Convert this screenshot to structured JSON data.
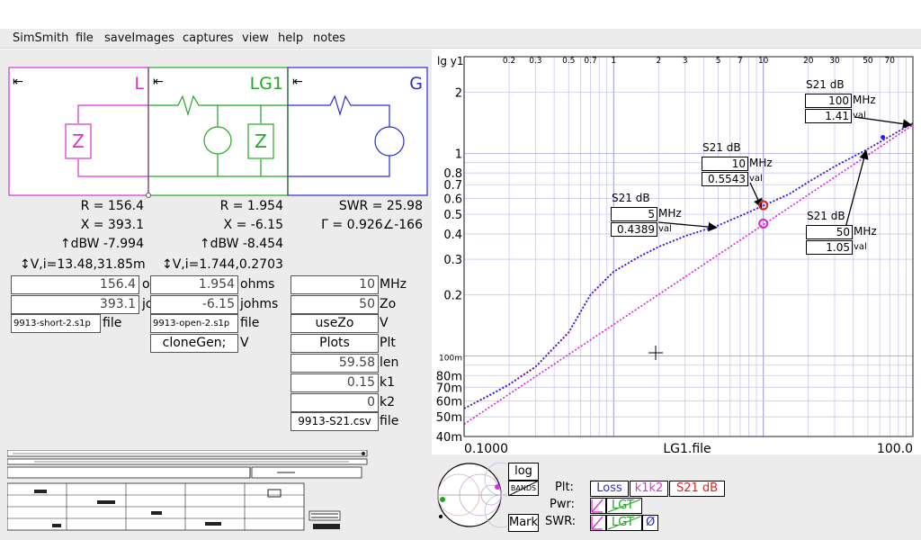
{
  "menu": {
    "items": [
      "SimSmith",
      "file",
      "saveImages",
      "captures",
      "view",
      "help",
      "notes"
    ]
  },
  "circuit": {
    "blocks": [
      {
        "name": "L",
        "color": "#d633d6"
      },
      {
        "name": "LG1",
        "color": "#22a822"
      },
      {
        "name": "G",
        "color": "#2a2ad6"
      }
    ],
    "arrow_glyph": "⇤",
    "z_glyph": "Z"
  },
  "readouts": {
    "col1": {
      "r": "R = 156.4",
      "x": "X = 393.1",
      "dbw": "↑dBW -7.994",
      "vi": "↕V,i=13.48,31.85m"
    },
    "col2": {
      "r": "R = 1.954",
      "x": "X = -6.15",
      "dbw": "↑dBW -8.454",
      "vi": "↕V,i=1.744,0.2703"
    },
    "col3": {
      "swr": "SWR = 25.98",
      "gamma": "Γ = 0.926∠-166"
    }
  },
  "fields": {
    "col1": [
      {
        "value": "156.4",
        "label": "ohms"
      },
      {
        "value": "393.1",
        "label": "johms"
      },
      {
        "value": "9913-short-2.s1p",
        "label": "file"
      }
    ],
    "col2": [
      {
        "value": "1.954",
        "label": "ohms"
      },
      {
        "value": "-6.15",
        "label": "johms"
      },
      {
        "value": "9913-open-2.s1p",
        "label": "file"
      },
      {
        "value": "cloneGen;",
        "label": "V"
      }
    ],
    "col3": [
      {
        "value": "10",
        "label": "MHz"
      },
      {
        "value": "50",
        "label": "Zo"
      },
      {
        "value": "useZo",
        "label": "V"
      },
      {
        "value": "Plots",
        "label": "Plt"
      },
      {
        "value": "59.58",
        "label": "len"
      },
      {
        "value": "0.15",
        "label": "k1"
      },
      {
        "value": "0",
        "label": "k2"
      },
      {
        "value": "9913-S21.csv",
        "label": "file"
      }
    ]
  },
  "chart_data": {
    "type": "line",
    "ylabel": "lg y1",
    "xlabel": "LG1.file",
    "x_scale": "log",
    "y_scale": "log",
    "xlim": [
      0.1,
      100
    ],
    "ylim": [
      0.04,
      3
    ],
    "x_top_ticks": [
      "0.2",
      "0.3",
      "0.5",
      "0.7",
      "1",
      "2",
      "3",
      "5",
      "7",
      "10",
      "20",
      "30",
      "50",
      "70"
    ],
    "x_bottom_ticks": [
      "0.1000",
      "100.0"
    ],
    "y_ticks": [
      "2",
      "1",
      "0.8",
      "0.7",
      "0.6",
      "0.5",
      "0.4",
      "0.3",
      "0.2",
      "100m",
      "80m",
      "70m",
      "60m",
      "50m",
      "40m"
    ],
    "grid": true,
    "series": [
      {
        "color": "#ff2020",
        "style": "dotted",
        "x": [
          0.1,
          0.15,
          0.2,
          0.3,
          0.5,
          0.7,
          1,
          1.5,
          2,
          3,
          5,
          7,
          10,
          15,
          20,
          30,
          50,
          100
        ],
        "y": [
          0.055,
          0.064,
          0.072,
          0.088,
          0.13,
          0.2,
          0.26,
          0.31,
          0.345,
          0.39,
          0.44,
          0.49,
          0.55,
          0.63,
          0.72,
          0.86,
          1.05,
          1.41
        ]
      },
      {
        "color": "#2020ff",
        "style": "dotted",
        "x": [
          0.1,
          0.15,
          0.2,
          0.3,
          0.5,
          0.7,
          1,
          1.5,
          2,
          3,
          5,
          7,
          10,
          15,
          20,
          30,
          50,
          100
        ],
        "y": [
          0.055,
          0.0645,
          0.0725,
          0.0885,
          0.131,
          0.201,
          0.261,
          0.311,
          0.346,
          0.391,
          0.441,
          0.491,
          0.552,
          0.632,
          0.722,
          0.862,
          1.052,
          1.41
        ]
      },
      {
        "color": "#e020e0",
        "style": "dotted",
        "x": [
          0.1,
          100
        ],
        "y": [
          0.046,
          1.38
        ]
      }
    ],
    "markers": [
      {
        "label": "S21 dB",
        "freq": "5",
        "unit": "MHz",
        "val": "0.4389",
        "val_unit": "val"
      },
      {
        "label": "S21 dB",
        "freq": "10",
        "unit": "MHz",
        "val": "0.5543",
        "val_unit": "val"
      },
      {
        "label": "S21 dB",
        "freq": "100",
        "unit": "MHz",
        "val": "1.41",
        "val_unit": "val"
      },
      {
        "label": "S21 dB",
        "freq": "50",
        "unit": "MHz",
        "val": "1.05",
        "val_unit": "val"
      }
    ]
  },
  "controls": {
    "log_label": "log",
    "bands_label": "BANDS",
    "mark_label": "Mark",
    "plt_label": "Plt:",
    "pwr_label": "Pwr:",
    "swr_label": "SWR:",
    "plt_loss": "Loss",
    "plt_k1k2": "k1k2",
    "plt_s21": "S21 dB",
    "lgt_label": "LGT",
    "z_slash": "Ø",
    "colors": {
      "loss": "#2a2ad6",
      "k1k2": "#d633d6",
      "s21": "#e02020",
      "lgt": "#22a822"
    }
  }
}
